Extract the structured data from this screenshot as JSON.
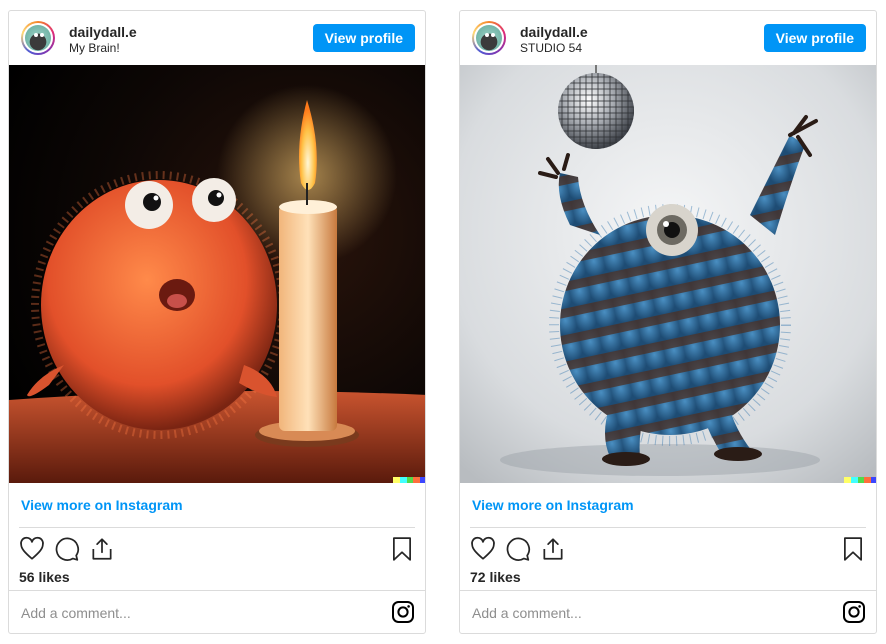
{
  "posts": [
    {
      "username": "dailydall.e",
      "caption_line": "My Brain!",
      "view_profile_label": "View profile",
      "view_more_label": "View more on Instagram",
      "likes": "56 likes",
      "comment_placeholder": "Add a comment...",
      "image_subject": "orange furry creature beside a lit candle"
    },
    {
      "username": "dailydall.e",
      "caption_line": "STUDIO 54",
      "view_profile_label": "View profile",
      "view_more_label": "View more on Instagram",
      "likes": "72 likes",
      "comment_placeholder": "Add a comment...",
      "image_subject": "blue striped furry monster dancing under a disco ball"
    }
  ],
  "icons": {
    "like": "heart-icon",
    "comment": "comment-icon",
    "share": "share-icon",
    "save": "bookmark-icon",
    "instagram": "instagram-icon"
  },
  "colors": {
    "accent": "#0095f6",
    "border": "#dbdbdb",
    "text": "#262626",
    "muted": "#8e8e8e"
  },
  "dalle_watermark_colors": [
    "#ffff66",
    "#42ffff",
    "#51da4c",
    "#ff6e3c",
    "#3c46ff"
  ]
}
